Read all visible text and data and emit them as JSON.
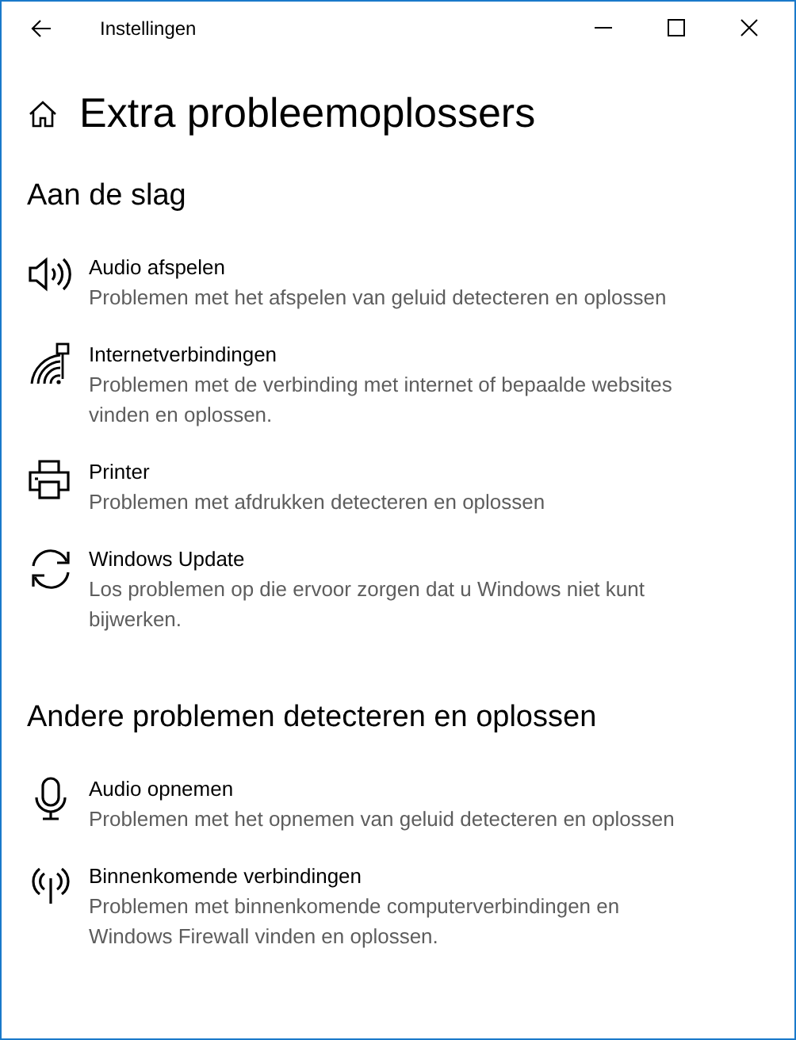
{
  "window": {
    "title": "Instellingen"
  },
  "page_title": "Extra probleemoplossers",
  "sections": [
    {
      "heading": "Aan de slag",
      "items": [
        {
          "kind": "speaker",
          "title": "Audio afspelen",
          "description": "Problemen met het afspelen van geluid detecteren en oplossen"
        },
        {
          "kind": "network",
          "title": "Internetverbindingen",
          "description": "Problemen met de verbinding met internet of bepaalde websites vinden en oplossen."
        },
        {
          "kind": "printer",
          "title": "Printer",
          "description": "Problemen met afdrukken detecteren en oplossen"
        },
        {
          "kind": "sync",
          "title": "Windows Update",
          "description": "Los problemen op die ervoor zorgen dat u Windows niet kunt bijwerken."
        }
      ]
    },
    {
      "heading": "Andere problemen detecteren en oplossen",
      "items": [
        {
          "kind": "microphone",
          "title": "Audio opnemen",
          "description": "Problemen met het opnemen van geluid detecteren en oplossen"
        },
        {
          "kind": "antenna",
          "title": "Binnenkomende verbindingen",
          "description": "Problemen met binnenkomende computerverbindingen en Windows Firewall vinden en oplossen."
        }
      ]
    }
  ]
}
